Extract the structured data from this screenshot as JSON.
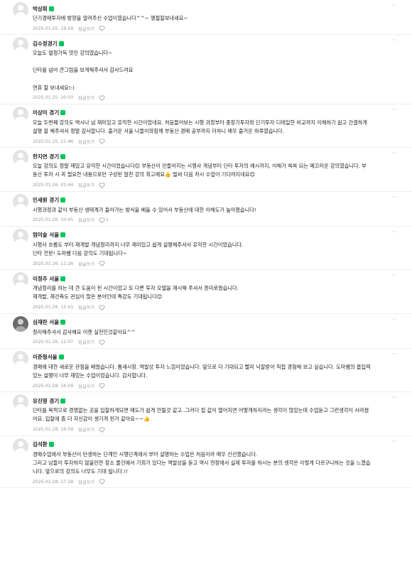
{
  "comments": [
    {
      "author": "박상희",
      "badge": true,
      "photo": false,
      "lines": [
        "단기경매투자에 방향을 알려주신 수업이였습니다^^~ 명절잘보내세요~"
      ],
      "date": "2025.01.25. 19:59",
      "reply_label": "답글쓰기",
      "likes": ""
    },
    {
      "author": "김수정경기",
      "badge": true,
      "photo": false,
      "lines": [
        "오늘도 열정가득 멋진 강의였습니다~",
        "",
        "단타를 넘어 큰그림을 보게해주셔서 감사드려요",
        "",
        "연휴 잘 보내세요!:)"
      ],
      "date": "2025.01.25. 20:50",
      "reply_label": "답글쓰기",
      "likes": ""
    },
    {
      "author": "이상미 경기",
      "badge": true,
      "photo": false,
      "lines": [
        "오늘 두번째 강의도 역시나 넘 재미있고 유익한 시간이었네요. 처음들어보는 시행 과정부터 중장기투자와 단기투자 디테일한 비교까지 이해하기 쉽고 간결하게 설명 잘 해주셔서 정말 감사합니다. 즐거운 서울 나들이와함께 부동산 경매 공부까지 더하니 매우 즐거운 하루였습니다."
      ],
      "date": "2025.01.25. 21:46",
      "reply_label": "답글쓰기",
      "likes": ""
    },
    {
      "author": "한지연 경기",
      "badge": true,
      "photo": false,
      "lines": [
        "오늘 강의도 정말 재밌고 유익한 시간이었습니다😊 부동산이 만들어지는 시행사 개념부터 단타 투자의 예시까지, 이해가 쏙쏙 되는 메끄러운 강의였습니다. 부동산 투자 시 꼭 필요한 내용으로만 구성된 알찬 강의 최고예요👍 벌써 다음 차시 수업이 기다려지네요😊"
      ],
      "date": "2025.01.26. 01:44",
      "reply_label": "답글쓰기",
      "likes": ""
    },
    {
      "author": "민세원 경기",
      "badge": true,
      "photo": false,
      "lines": [
        "시행과정과 같이 부동산 생태계가 돌아가는 방식을 배울 수 있어서 부동산에 대한 이해도가 높아졌습니다!"
      ],
      "date": "2025.01.26. 10:45",
      "reply_label": "답글쓰기",
      "likes": "1"
    },
    {
      "author": "엄미술 서울",
      "badge": true,
      "photo": false,
      "lines": [
        "시행사 흐름도 부터 재개발 개념정리까지 너무 재미있고 쉽게 설명해주셔서 유익한 시간이었습니다.",
        "단타 전문! 도마쌤 다음 강의도 기대됩니다~"
      ],
      "date": "2025.01.26. 11:26",
      "reply_label": "답글쓰기",
      "likes": ""
    },
    {
      "author": "이정주 서울",
      "badge": true,
      "photo": false,
      "lines": [
        "개념정리를 하는 데 큰 도움이 된 시간이었고 또 다른 투자 모델을 제시해 주셔서 흥미로웠습니다.",
        "재개발, 재건축도 관심이 많은 분야인데 특강도 기대됩니다😊"
      ],
      "date": "2025.01.26. 12:01",
      "reply_label": "답글쓰기",
      "likes": ""
    },
    {
      "author": "심재란 서울",
      "badge": true,
      "photo": true,
      "lines": [
        "정리해주셔서 감사해요 이젠 실천인것같아요^^"
      ],
      "date": "2025.01.26. 12:07",
      "reply_label": "답글쓰기",
      "likes": ""
    },
    {
      "author": "이준형서울",
      "badge": true,
      "photo": false,
      "lines": [
        "경매에 대한 새로운 관점을 배웠습니다. 틈새시장. 역발상 투자 느낌이었습니다. 앞으로 더 기대되고 빨리 낙찰받아 직접 경험해 보고 싶습니다. 도마쌤의 흡입력있는 설명이 너무 재밌는 수업이었습니다. 감사합니다."
      ],
      "date": "2025.01.28. 16:59",
      "reply_label": "답글쓰기",
      "likes": ""
    },
    {
      "author": "유진영 경기",
      "badge": true,
      "photo": false,
      "lines": [
        "단타를 목적으로 경쟁없는 곳을 입찰하게되면 매도가 쉽게 안될것 같고..그러다 집 값이 떨어지면 어떻게하지라는 생각이 많았는데 수업듣고 그런생각이 사라졌어요. 입찰에 좀 더 자신감이 생기게 된거 같아요~~👍"
      ],
      "date": "2025.01.28. 16:59",
      "reply_label": "답글쓰기",
      "likes": ""
    },
    {
      "author": "김석환",
      "badge": true,
      "photo": false,
      "lines": [
        "경매수업에서 부동산이 탄생하는 단계인 시행단계에서 부터 설명하는 수업은 처음이라 매우 신선했습니다.",
        "그리고 남들이 투자하지 않을만한 장소 물건에서 기회가 있다는 역발상을 듣고 역시 현장에서 실제 투자를 하시는 분의 생각은 이렇게 다르구나하는 것을 느꼈습니다. 앞으로의 강의도 너무도 기대 됩니다.!!"
      ],
      "date": "2025.01.28. 17:28",
      "reply_label": "답글쓰기",
      "likes": ""
    }
  ]
}
